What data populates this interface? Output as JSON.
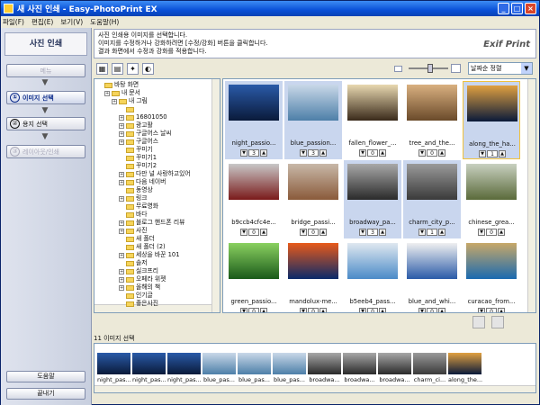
{
  "window": {
    "title": "새 사진 인쇄 - Easy-PhotoPrint EX"
  },
  "menu": [
    "파일(F)",
    "편집(E)",
    "보기(V)",
    "도움말(H)"
  ],
  "sidebar": {
    "title": "사진 인쇄",
    "menu_label": "메뉴",
    "steps": [
      {
        "num": "①",
        "label": "이미지 선택",
        "state": "active"
      },
      {
        "num": "②",
        "label": "용지 선택",
        "state": "enabled"
      },
      {
        "num": "③",
        "label": "레이아웃/인쇄",
        "state": "disabled"
      }
    ],
    "help_label": "도움말",
    "exit_label": "끝내기"
  },
  "instructions": {
    "lines": [
      "사진 인쇄용 이미지를 선택합니다.",
      "이미지를 수정하거나 강화하려면 [수정/강화] 버튼을 클릭합니다.",
      "결과 화면에서 수정과 강화를 적용합니다."
    ],
    "logo": "Exif Print"
  },
  "toolbar": {
    "sort_label": "날짜순 정렬",
    "zoom_level": 0.55
  },
  "tree": {
    "items": [
      {
        "label": "바탕 화면",
        "depth": 0,
        "plus": false
      },
      {
        "label": "내 문서",
        "depth": 1,
        "plus": true
      },
      {
        "label": "내 그림",
        "depth": 2,
        "plus": true
      },
      {
        "label": "",
        "depth": 3,
        "plus": false
      },
      {
        "label": "16801050",
        "depth": 3,
        "plus": true
      },
      {
        "label": "광고활",
        "depth": 3,
        "plus": true
      },
      {
        "label": "구글어스 날씨",
        "depth": 3,
        "plus": true
      },
      {
        "label": "구글어스",
        "depth": 3,
        "plus": true
      },
      {
        "label": "꾸미기",
        "depth": 3,
        "plus": false
      },
      {
        "label": "꾸미기1",
        "depth": 3,
        "plus": false
      },
      {
        "label": "꾸미기2",
        "depth": 3,
        "plus": false
      },
      {
        "label": "다만 널 사랑하고있어",
        "depth": 3,
        "plus": true
      },
      {
        "label": "다음 네이버",
        "depth": 3,
        "plus": true
      },
      {
        "label": "동영상",
        "depth": 3,
        "plus": false
      },
      {
        "label": "링크",
        "depth": 3,
        "plus": true
      },
      {
        "label": "무료영화",
        "depth": 3,
        "plus": false
      },
      {
        "label": "바다",
        "depth": 3,
        "plus": false
      },
      {
        "label": "블로그 핸드폰 리뷰",
        "depth": 3,
        "plus": true
      },
      {
        "label": "사진",
        "depth": 3,
        "plus": true
      },
      {
        "label": "새 폴더",
        "depth": 3,
        "plus": false
      },
      {
        "label": "새 폴더 (2)",
        "depth": 3,
        "plus": false
      },
      {
        "label": "세상을 바꾼 101",
        "depth": 3,
        "plus": true
      },
      {
        "label": "솔저",
        "depth": 3,
        "plus": false
      },
      {
        "label": "실크프리",
        "depth": 3,
        "plus": true
      },
      {
        "label": "오페라 위젯",
        "depth": 3,
        "plus": true
      },
      {
        "label": "올해의 책",
        "depth": 3,
        "plus": true
      },
      {
        "label": "인기글",
        "depth": 3,
        "plus": false
      },
      {
        "label": "좋은사진",
        "depth": 3,
        "plus": false
      }
    ]
  },
  "grid": {
    "cells": [
      {
        "name": "night_passio...",
        "count": "3",
        "selected": true,
        "colors": [
          "#0a1a3a",
          "#2a5aa8"
        ]
      },
      {
        "name": "blue_passion...",
        "count": "3",
        "selected": true,
        "colors": [
          "#4d7fa8",
          "#c9d8e8"
        ]
      },
      {
        "name": "fallen_flower_...",
        "count": "0",
        "selected": false,
        "colors": [
          "#3a2a1a",
          "#e8d8b0"
        ]
      },
      {
        "name": "tree_and_the...",
        "count": "0",
        "selected": false,
        "colors": [
          "#6a4a2a",
          "#d9b080"
        ]
      },
      {
        "name": "along_the_ha...",
        "count": "1",
        "selected": true,
        "focus": true,
        "colors": [
          "#0a1a3a",
          "#e0a040"
        ]
      },
      {
        "name": "b9ccb4cfc4e...",
        "count": "0",
        "selected": false,
        "colors": [
          "#7a1a1a",
          "#c8c8c8"
        ]
      },
      {
        "name": "bridge_passi...",
        "count": "0",
        "selected": false,
        "colors": [
          "#8a5a3a",
          "#c8b8a8"
        ]
      },
      {
        "name": "broadway_pa...",
        "count": "3",
        "selected": true,
        "colors": [
          "#2a2a2a",
          "#a8a8a8"
        ]
      },
      {
        "name": "charm_city_p...",
        "count": "1",
        "selected": true,
        "colors": [
          "#3a3a3a",
          "#9a9a9a"
        ]
      },
      {
        "name": "chinese_grea...",
        "count": "0",
        "selected": false,
        "colors": [
          "#5a6a3a",
          "#c8d0c0"
        ]
      },
      {
        "name": "green_passio...",
        "count": "0",
        "selected": false,
        "colors": [
          "#1a5a1a",
          "#8ad060"
        ]
      },
      {
        "name": "mandolux-me...",
        "count": "0",
        "selected": false,
        "colors": [
          "#0a2a6a",
          "#e85a1a"
        ]
      },
      {
        "name": "b5eeb4_pass...",
        "count": "0",
        "selected": false,
        "colors": [
          "#4a8ac8",
          "#e0e8f0"
        ]
      },
      {
        "name": "blue_and_whi...",
        "count": "0",
        "selected": false,
        "colors": [
          "#2a5aa8",
          "#f0f0f0"
        ]
      },
      {
        "name": "curacao_from...",
        "count": "0",
        "selected": false,
        "colors": [
          "#1a6ab0",
          "#c8a868"
        ]
      }
    ]
  },
  "selection": {
    "header": "11 이미지 선택",
    "items": [
      {
        "label": "night_pas...",
        "colors": [
          "#0a1a3a",
          "#2a5aa8"
        ]
      },
      {
        "label": "night_pas...",
        "colors": [
          "#0a1a3a",
          "#2a5aa8"
        ]
      },
      {
        "label": "night_pas...",
        "colors": [
          "#0a1a3a",
          "#2a5aa8"
        ]
      },
      {
        "label": "blue_pas...",
        "colors": [
          "#4d7fa8",
          "#c9d8e8"
        ]
      },
      {
        "label": "blue_pas...",
        "colors": [
          "#4d7fa8",
          "#c9d8e8"
        ]
      },
      {
        "label": "blue_pas...",
        "colors": [
          "#4d7fa8",
          "#c9d8e8"
        ]
      },
      {
        "label": "broadwa...",
        "colors": [
          "#2a2a2a",
          "#a8a8a8"
        ]
      },
      {
        "label": "broadwa...",
        "colors": [
          "#2a2a2a",
          "#a8a8a8"
        ]
      },
      {
        "label": "broadwa...",
        "colors": [
          "#2a2a2a",
          "#a8a8a8"
        ]
      },
      {
        "label": "charm_ci...",
        "colors": [
          "#3a3a3a",
          "#9a9a9a"
        ]
      },
      {
        "label": "along_the...",
        "colors": [
          "#0a1a3a",
          "#e0a040"
        ]
      }
    ]
  }
}
